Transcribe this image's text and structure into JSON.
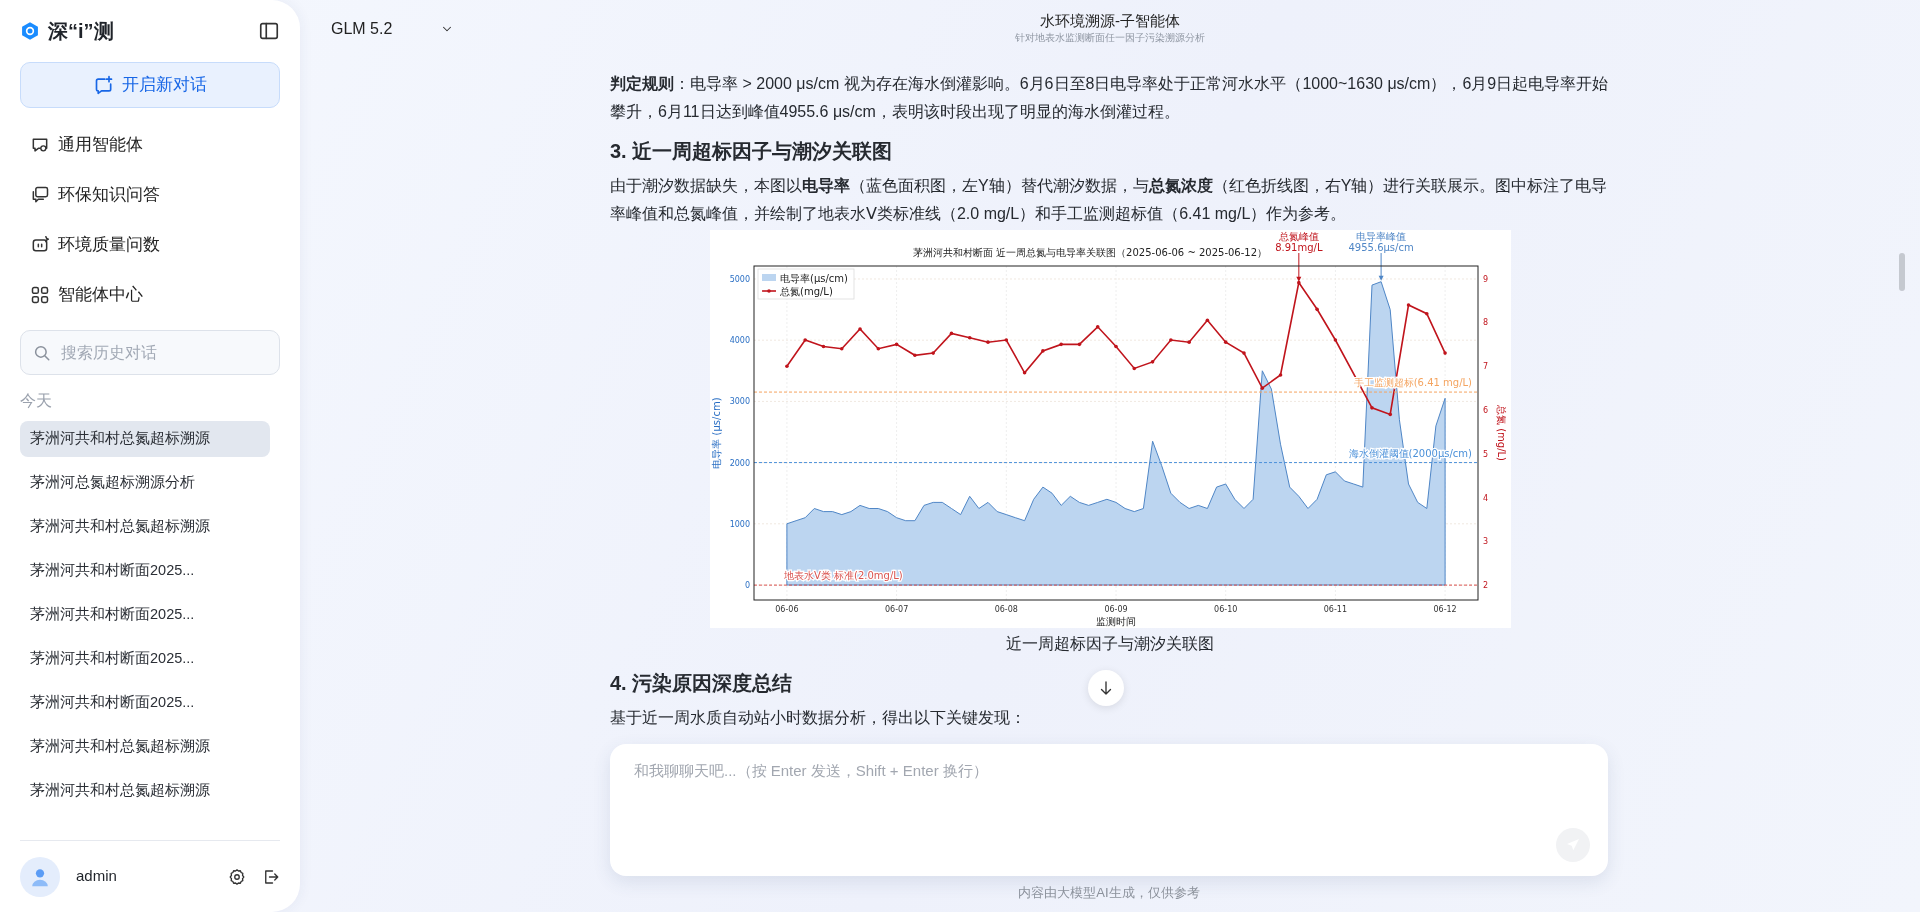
{
  "sidebar": {
    "brand": "深“i”测",
    "new_chat": "开启新对话",
    "nav": [
      {
        "label": "通用智能体",
        "kind": "chat"
      },
      {
        "label": "环保知识问答",
        "kind": "knowledge"
      },
      {
        "label": "环境质量问数",
        "kind": "data"
      },
      {
        "label": "智能体中心",
        "kind": "grid"
      }
    ],
    "search": {
      "placeholder": "搜索历史对话"
    },
    "history_group": "今天",
    "history": [
      {
        "title": "茅洲河共和村总氮超标溯源",
        "selected": true
      },
      {
        "title": "茅洲河总氮超标溯源分析",
        "selected": false
      },
      {
        "title": "茅洲河共和村总氮超标溯源",
        "selected": false
      },
      {
        "title": "茅洲河共和村断面2025...",
        "selected": false
      },
      {
        "title": "茅洲河共和村断面2025...",
        "selected": false
      },
      {
        "title": "茅洲河共和村断面2025...",
        "selected": false
      },
      {
        "title": "茅洲河共和村断面2025...",
        "selected": false
      },
      {
        "title": "茅洲河共和村总氮超标溯源",
        "selected": false
      },
      {
        "title": "茅洲河共和村总氮超标溯源",
        "selected": false
      }
    ],
    "user": {
      "name": "admin"
    }
  },
  "header": {
    "model": "GLM 5.2",
    "title": "水环境溯源-子智能体",
    "subtitle": "针对地表水监测断面任一因子污染溯源分析"
  },
  "content": [
    {
      "kind": "paragraph",
      "text": "**判定规则**：电导率 > 2000 μs/cm 视为存在海水倒灌影响。6月6日至8日电导率处于正常河水水平（1000~1630 μs/cm），6月9日起电导率开始攀升，6月11日达到峰值4955.6 μs/cm，表明该时段出现了明显的海水倒灌过程。"
    },
    {
      "kind": "heading",
      "text": "3. 近一周超标因子与潮汐关联图"
    },
    {
      "kind": "paragraph",
      "text": "由于潮汐数据缺失，本图以**电导率**（蓝色面积图，左Y轴）替代潮汐数据，与**总氮浓度**（红色折线图，右Y轴）进行关联展示。图中标注了电导率峰值和总氮峰值，并绘制了地表水Ⅴ类标准线（2.0 mg/L）和手工监测超标值（6.41 mg/L）作为参考。"
    },
    {
      "kind": "figure",
      "caption": "近一周超标因子与潮汐关联图",
      "chart_data": {
        "type": "line",
        "title": "茅洲河共和村断面 近一周总氮与电导率关联图（2025-06-06 ~ 2025-06-12）",
        "xlabel": "监测时间",
        "ylabel": "电导率 (μs/cm)",
        "y2label": "总氮 (mg/L)",
        "grid": true,
        "legend": "upper left",
        "ylim": [
          -245,
          5212
        ],
        "y2lim": [
          1.66,
          9.29
        ],
        "categories": [
          "06-06",
          null,
          null,
          null,
          null,
          null,
          null,
          null,
          null,
          null,
          null,
          null,
          "06-07",
          null,
          null,
          null,
          null,
          null,
          null,
          null,
          null,
          null,
          null,
          null,
          "06-08",
          null,
          null,
          null,
          null,
          null,
          null,
          null,
          null,
          null,
          null,
          null,
          "06-09",
          null,
          null,
          null,
          null,
          null,
          null,
          null,
          null,
          null,
          null,
          null,
          "06-10",
          null,
          null,
          null,
          null,
          null,
          null,
          null,
          null,
          null,
          null,
          null,
          "06-11",
          null,
          null,
          null,
          null,
          null,
          null,
          null,
          null,
          null,
          null,
          null,
          "06-12"
        ],
        "yticks": [
          0,
          1000,
          2000,
          3000,
          4000,
          5000
        ],
        "y2ticks": [
          2,
          3,
          4,
          5,
          6,
          7,
          8,
          9
        ],
        "series": [
          {
            "name": "电导率(μs/cm)",
            "type": "area",
            "color": "#4f86c6",
            "values": [
              1000,
              1050,
              1100,
              1250,
              1200,
              1200,
              1150,
              1200,
              1300,
              1250,
              1250,
              1200,
              1100,
              1050,
              1050,
              1300,
              1350,
              1350,
              1250,
              1150,
              1450,
              1250,
              1350,
              1200,
              1150,
              1100,
              1050,
              1400,
              1600,
              1500,
              1300,
              1450,
              1350,
              1300,
              1350,
              1400,
              1350,
              1250,
              1200,
              1250,
              2350,
              1950,
              1500,
              1350,
              1250,
              1300,
              1250,
              1600,
              1650,
              1400,
              1250,
              1400,
              3500,
              3200,
              2300,
              1600,
              1450,
              1250,
              1400,
              1800,
              1850,
              1700,
              1650,
              1600,
              4900,
              4955.6,
              4500,
              2700,
              1650,
              1350,
              1250,
              2600,
              3050
            ]
          },
          {
            "name": "总氮(mg/L)",
            "type": "line",
            "axis": "y2",
            "color": "#c0141c",
            "values": [
              7.0,
              null,
              7.6,
              null,
              7.45,
              null,
              7.4,
              null,
              7.85,
              null,
              7.4,
              null,
              7.5,
              null,
              7.25,
              null,
              7.3,
              null,
              7.75,
              null,
              7.65,
              null,
              7.55,
              null,
              7.6,
              null,
              6.85,
              null,
              7.35,
              null,
              7.5,
              null,
              7.5,
              null,
              7.9,
              null,
              7.45,
              null,
              6.95,
              null,
              7.1,
              null,
              7.6,
              null,
              7.55,
              null,
              8.05,
              null,
              7.55,
              null,
              7.3,
              null,
              6.5,
              null,
              6.8,
              null,
              8.91,
              null,
              8.3,
              null,
              7.6,
              null,
              null,
              null,
              6.05,
              null,
              5.9,
              null,
              8.4,
              null,
              8.2,
              null,
              7.3
            ]
          }
        ],
        "ref_lines": [
          {
            "axis": "y2",
            "value": 6.41,
            "label": "手工监测超标(6.41 mg/L)",
            "color": "#f4a460"
          },
          {
            "axis": "y",
            "value": 2000,
            "label": "海水倒灌阈值(2000μs/cm)",
            "color": "#4a90d9"
          },
          {
            "axis": "y2",
            "value": 2.0,
            "label": "地表水Ⅴ类 标准(2.0mg/L)",
            "color": "#d9534f"
          }
        ],
        "annotations": [
          "电导率峰值\n4955.6μs/cm",
          "总氮峰值\n8.91mg/L"
        ]
      }
    },
    {
      "kind": "heading",
      "text": "4. 污染原因深度总结"
    },
    {
      "kind": "paragraph",
      "text": "基于近一周水质自动站小时数据分析，得出以下关键发现："
    }
  ],
  "composer": {
    "placeholder": "和我聊聊天吧...（按 Enter 发送，Shift + Enter 换行）"
  },
  "disclaimer": "内容由大模型AI生成，仅供参考"
}
